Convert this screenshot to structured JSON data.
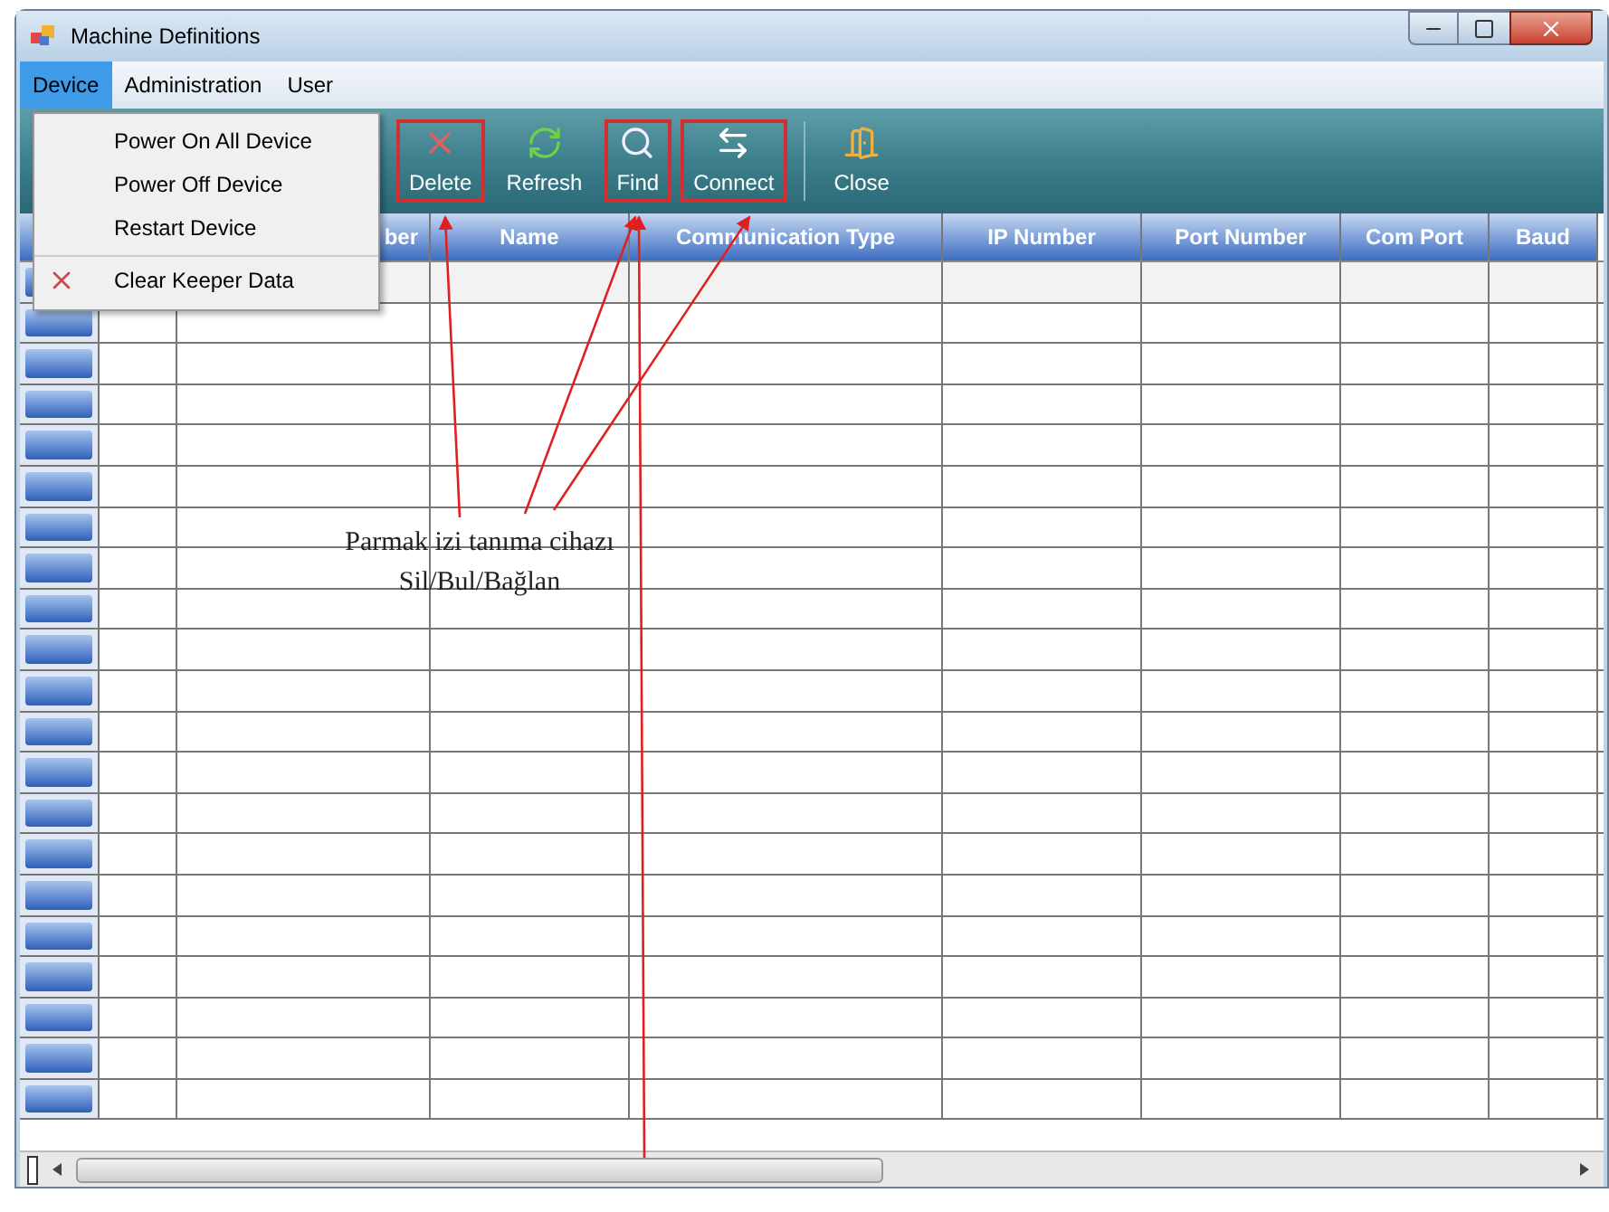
{
  "window": {
    "title": "Machine Definitions"
  },
  "menu": [
    {
      "label": "Device",
      "selected": true
    },
    {
      "label": "Administration",
      "selected": false
    },
    {
      "label": "User",
      "selected": false
    }
  ],
  "dropdown": [
    {
      "label": "Power On All Device",
      "has_icon": false,
      "separator_before": false
    },
    {
      "label": "Power Off Device",
      "has_icon": false,
      "separator_before": false
    },
    {
      "label": "Restart Device",
      "has_icon": false,
      "separator_before": false
    },
    {
      "label": "Clear Keeper Data",
      "has_icon": true,
      "separator_before": true
    }
  ],
  "toolbar": [
    {
      "label": "Delete",
      "kind": "delete",
      "highlighted": true
    },
    {
      "label": "Refresh",
      "kind": "refresh",
      "highlighted": false
    },
    {
      "label": "Find",
      "kind": "find",
      "highlighted": true
    },
    {
      "label": "Connect",
      "kind": "connect",
      "highlighted": true
    },
    {
      "label": "Close",
      "kind": "close",
      "highlighted": false
    }
  ],
  "table": {
    "columns": [
      "ber",
      "Name",
      "Communication Type",
      "IP Number",
      "Port Number",
      "Com Port",
      "Baud"
    ]
  },
  "annotation": {
    "lines": [
      "Parmak izi tanıma cihazı",
      "Sil/Bul/Bağlan"
    ]
  }
}
